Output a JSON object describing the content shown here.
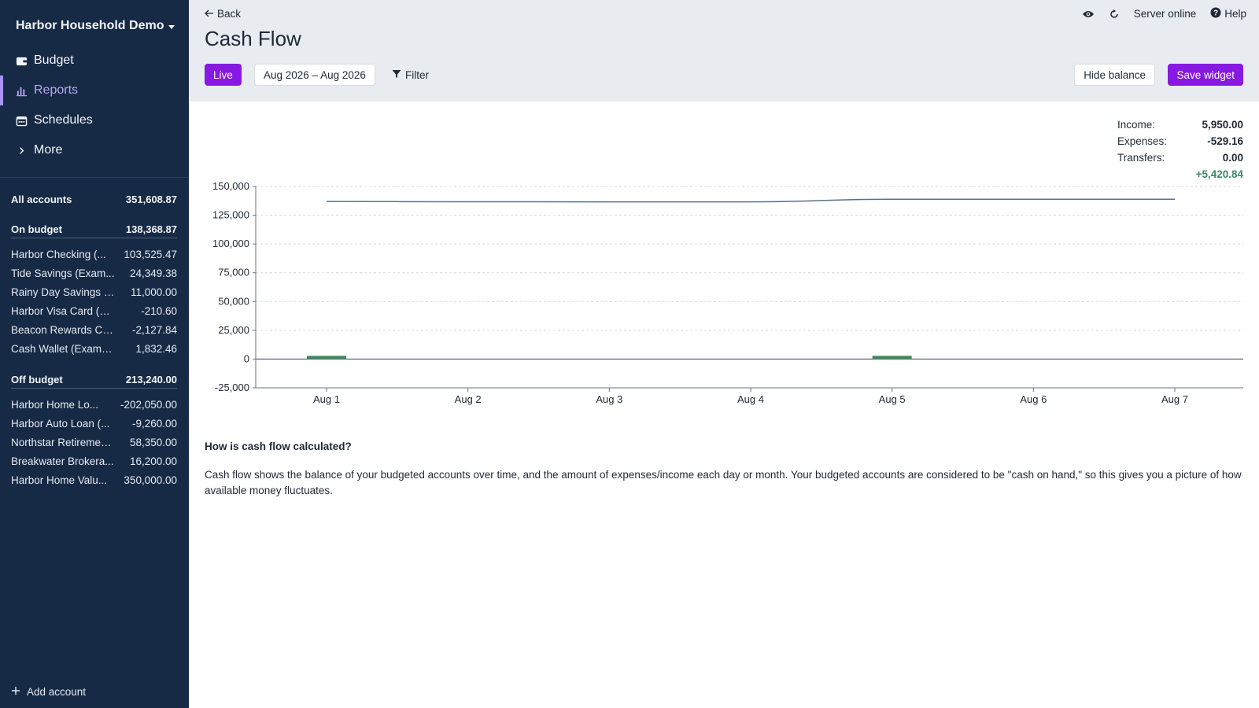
{
  "sidebar": {
    "budget_name": "Harbor Household Demo",
    "nav": [
      {
        "label": "Budget",
        "icon": "wallet-icon"
      },
      {
        "label": "Reports",
        "icon": "bar-chart-icon",
        "active": true
      },
      {
        "label": "Schedules",
        "icon": "calendar-icon"
      },
      {
        "label": "More",
        "icon": "chevron-right-icon"
      }
    ],
    "all_accounts": {
      "label": "All accounts",
      "balance": "351,608.87"
    },
    "on_budget": {
      "label": "On budget",
      "balance": "138,368.87",
      "accounts": [
        {
          "name": "Harbor Checking (...",
          "balance": "103,525.47"
        },
        {
          "name": "Tide Savings (Exam...",
          "balance": "24,349.38"
        },
        {
          "name": "Rainy Day Savings (...",
          "balance": "11,000.00"
        },
        {
          "name": "Harbor Visa Card (Ex...",
          "balance": "-210.60"
        },
        {
          "name": "Beacon Rewards Ca...",
          "balance": "-2,127.84"
        },
        {
          "name": "Cash Wallet (Example)",
          "balance": "1,832.46"
        }
      ]
    },
    "off_budget": {
      "label": "Off budget",
      "balance": "213,240.00",
      "accounts": [
        {
          "name": "Harbor Home Lo...",
          "balance": "-202,050.00"
        },
        {
          "name": "Harbor Auto Loan (...",
          "balance": "-9,260.00"
        },
        {
          "name": "Northstar Retiremen...",
          "balance": "58,350.00"
        },
        {
          "name": "Breakwater Brokera...",
          "balance": "16,200.00"
        },
        {
          "name": "Harbor Home Valu...",
          "balance": "350,000.00"
        }
      ]
    },
    "add_account": "Add account"
  },
  "header": {
    "back": "Back",
    "title": "Cash Flow",
    "server_status": "Server online",
    "help": "Help"
  },
  "toolbar": {
    "live": "Live",
    "date_range": "Aug 2026 – Aug 2026",
    "filter": "Filter",
    "hide_balance": "Hide balance",
    "save_widget": "Save widget"
  },
  "totals": {
    "income_label": "Income:",
    "income": "5,950.00",
    "expenses_label": "Expenses:",
    "expenses": "-529.16",
    "transfers_label": "Transfers:",
    "transfers": "0.00",
    "net": "+5,420.84"
  },
  "colors": {
    "accent": "#8719e0",
    "sidebar_bg": "#172a45",
    "balance_line": "#5b6f8a",
    "income_bar": "#3e8a63",
    "positive_text": "#3e8a63"
  },
  "chart_data": {
    "type": "line",
    "title": "",
    "categories": [
      "Aug 1",
      "Aug 2",
      "Aug 3",
      "Aug 4",
      "Aug 5",
      "Aug 6",
      "Aug 7"
    ],
    "yticks": [
      "150,000",
      "125,000",
      "100,000",
      "75,000",
      "50,000",
      "25,000",
      "0",
      "-25,000"
    ],
    "ylim": [
      -25000,
      150000
    ],
    "grid": true,
    "series": [
      {
        "kind": "line",
        "values": [
          136900,
          136700,
          136600,
          136600,
          138900,
          138900,
          138900
        ]
      },
      {
        "kind": "bar",
        "values": [
          2800,
          0,
          0,
          0,
          2800,
          0,
          0
        ]
      }
    ]
  },
  "faq": {
    "question": "How is cash flow calculated?",
    "answer": "Cash flow shows the balance of your budgeted accounts over time, and the amount of expenses/income each day or month. Your budgeted accounts are considered to be \"cash on hand,\" so this gives you a picture of how available money fluctuates."
  }
}
